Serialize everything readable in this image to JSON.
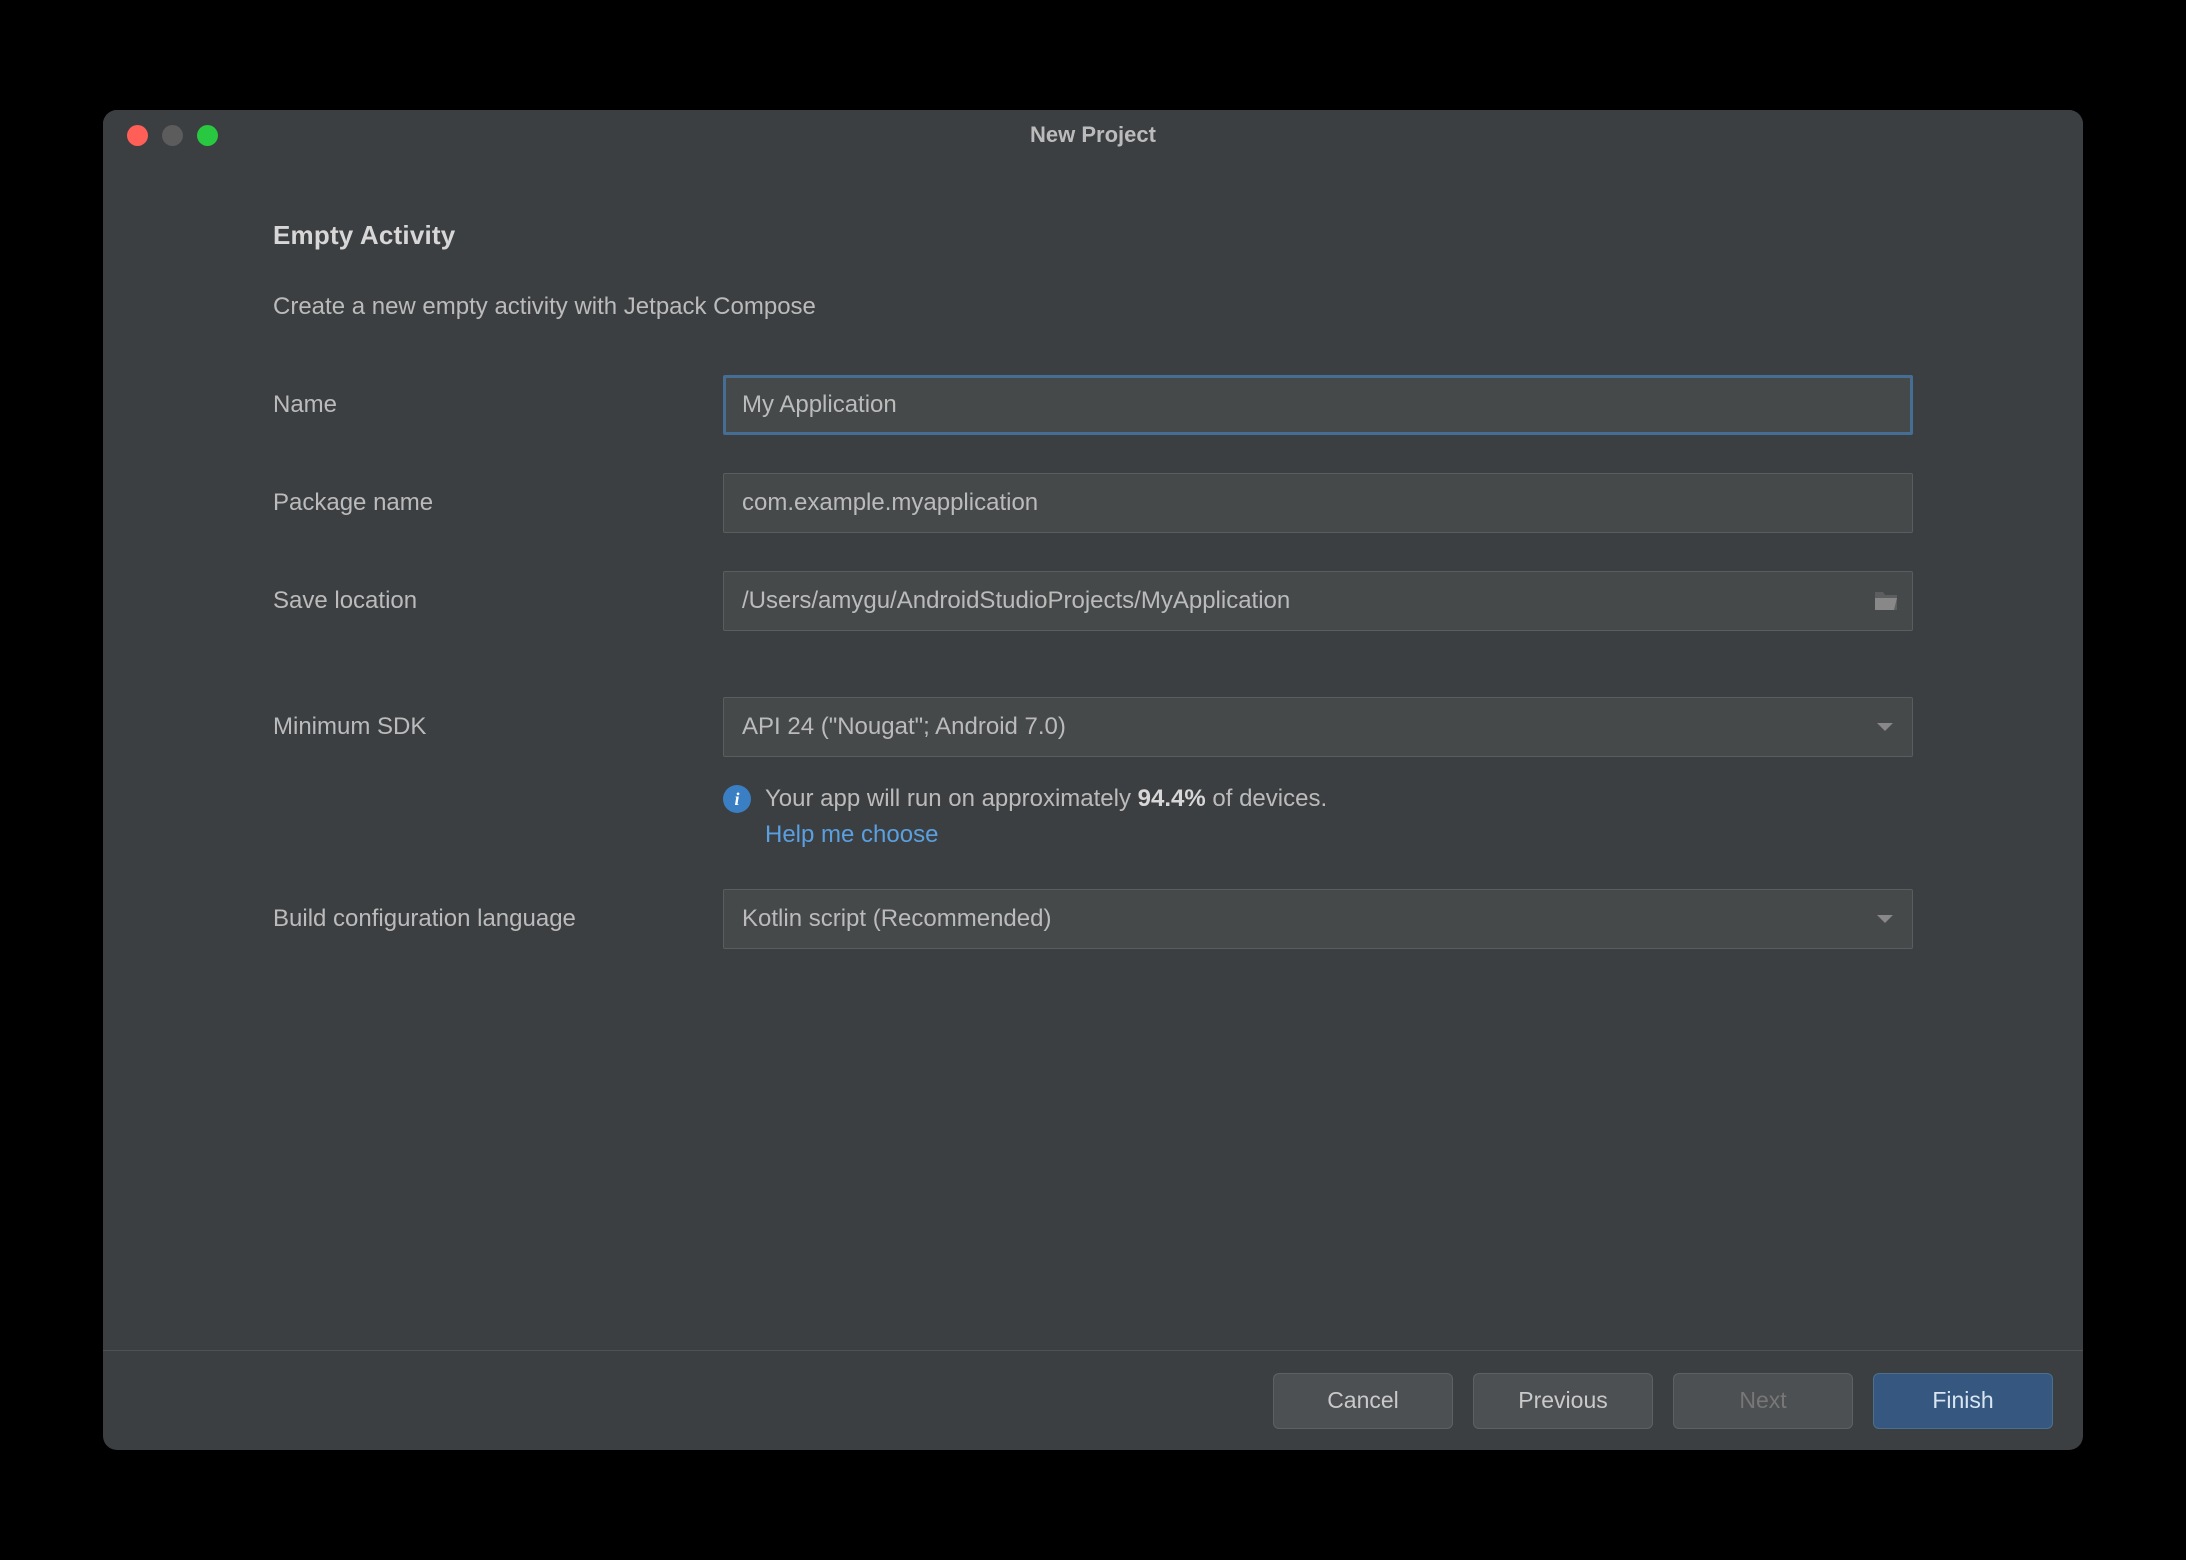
{
  "window": {
    "title": "New Project"
  },
  "page": {
    "heading": "Empty Activity",
    "subheading": "Create a new empty activity with Jetpack Compose"
  },
  "form": {
    "name": {
      "label": "Name",
      "value": "My Application"
    },
    "package_name": {
      "label": "Package name",
      "value": "com.example.myapplication"
    },
    "save_location": {
      "label": "Save location",
      "value": "/Users/amygu/AndroidStudioProjects/MyApplication"
    },
    "min_sdk": {
      "label": "Minimum SDK",
      "value": "API 24 (\"Nougat\"; Android 7.0)",
      "info_prefix": "Your app will run on approximately ",
      "info_percent": "94.4%",
      "info_suffix": " of devices.",
      "help_link": "Help me choose"
    },
    "build_lang": {
      "label": "Build configuration language",
      "value": "Kotlin script (Recommended)"
    }
  },
  "footer": {
    "cancel": "Cancel",
    "previous": "Previous",
    "next": "Next",
    "finish": "Finish"
  }
}
